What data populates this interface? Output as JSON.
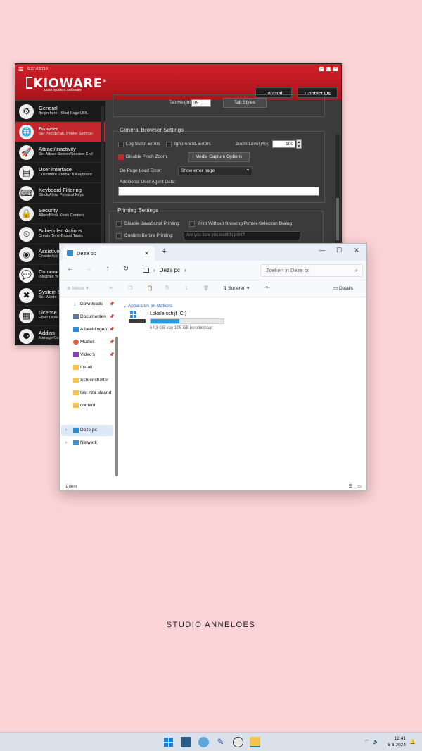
{
  "kioware": {
    "version": "8.37.0.5719",
    "logo": "KIOWARE",
    "tagline": "kiosk system software",
    "journal_button": "Journal",
    "contact_button": "Contact Us",
    "sidebar": [
      {
        "title": "General",
        "subtitle": "Begin here - Start Page URL",
        "icon": "gear-icon"
      },
      {
        "title": "Browser",
        "subtitle": "Set Popup/Tab, Printer Settings",
        "icon": "browser-icon",
        "active": true
      },
      {
        "title": "Attract/Inactivity",
        "subtitle": "Set Attract Screen/Session End",
        "icon": "rocket-icon"
      },
      {
        "title": "User Interface",
        "subtitle": "Customize Toolbar & Keyboard",
        "icon": "window-icon"
      },
      {
        "title": "Keyboard Filtering",
        "subtitle": "Block/Allow Physical Keys",
        "icon": "keyboard-icon"
      },
      {
        "title": "Security",
        "subtitle": "Allow/Block Kiosk Content",
        "icon": "lock-icon"
      },
      {
        "title": "Scheduled Actions",
        "subtitle": "Create Time-Based Tasks",
        "icon": "clock-icon"
      },
      {
        "title": "Assistive",
        "subtitle": "Enable Acc",
        "icon": "eye-icon"
      },
      {
        "title": "Commun",
        "subtitle": "Integrate W",
        "icon": "chat-icon"
      },
      {
        "title": "System S",
        "subtitle": "Set Windo",
        "icon": "tools-icon"
      },
      {
        "title": "License",
        "subtitle": "Enter Licen",
        "icon": "license-icon"
      },
      {
        "title": "Addins",
        "subtitle": "Manage Cu",
        "icon": "addin-icon"
      }
    ],
    "tab_height_label": "Tab Height:",
    "tab_height_value": "35",
    "tab_styles_button": "Tab Styles",
    "general_browser": {
      "title": "General Browser Settings",
      "log_script_errors": "Log Script Errors",
      "ignore_ssl": "Ignore SSL Errors",
      "zoom_label": "Zoom Level (%):",
      "zoom_value": "100",
      "disable_pinch": "Disable Pinch Zoom",
      "media_capture_button": "Media Capture Options",
      "page_load_error_label": "On Page Load Error:",
      "page_load_error_value": "Show error page",
      "user_agent_label": "Additional User Agent Data:",
      "user_agent_value": ""
    },
    "printing": {
      "title": "Printing Settings",
      "disable_js_printing": "Disable JavaScript Printing",
      "print_without_dialog": "Print Without Showing Printer-Selection Dialog",
      "confirm_before_printing": "Confirm Before Printing:",
      "confirm_placeholder": "Are you sure you want to print?"
    },
    "colors": {
      "header": "#c9262c",
      "active": "#c3282f"
    }
  },
  "explorer": {
    "tab_title": "Deze pc",
    "address": "Deze pc",
    "search_placeholder": "Zoeken in Deze pc",
    "toolbar": {
      "new": "Nieuw",
      "sort": "Sorteren",
      "more": "•••",
      "details": "Details"
    },
    "nav_items": [
      {
        "label": "Downloads",
        "icon": "download-icon",
        "pinned": true
      },
      {
        "label": "Documenten",
        "icon": "document-icon",
        "pinned": true
      },
      {
        "label": "Afbeeldingen",
        "icon": "image-icon",
        "pinned": true
      },
      {
        "label": "Muziek",
        "icon": "music-icon",
        "pinned": true
      },
      {
        "label": "Video's",
        "icon": "video-icon",
        "pinned": true
      },
      {
        "label": "Install",
        "icon": "folder-icon"
      },
      {
        "label": "Screenshotter",
        "icon": "folder-icon"
      },
      {
        "label": "test nza staand",
        "icon": "folder-icon"
      },
      {
        "label": "content",
        "icon": "folder-icon"
      }
    ],
    "tree": [
      {
        "label": "Deze pc",
        "icon": "computer-icon",
        "selected": true
      },
      {
        "label": "Netwerk",
        "icon": "network-icon"
      }
    ],
    "section_title": "Apparaten en stations",
    "drive": {
      "name": "Lokale schijf (C:)",
      "usage_text": "64,3 GB van 105 GB beschikbaar",
      "used_fraction": 0.39
    },
    "status": "1 item"
  },
  "background_text": "STUDIO ANNELOES",
  "taskbar": {
    "time": "12:41",
    "date": "6-8-2024"
  }
}
